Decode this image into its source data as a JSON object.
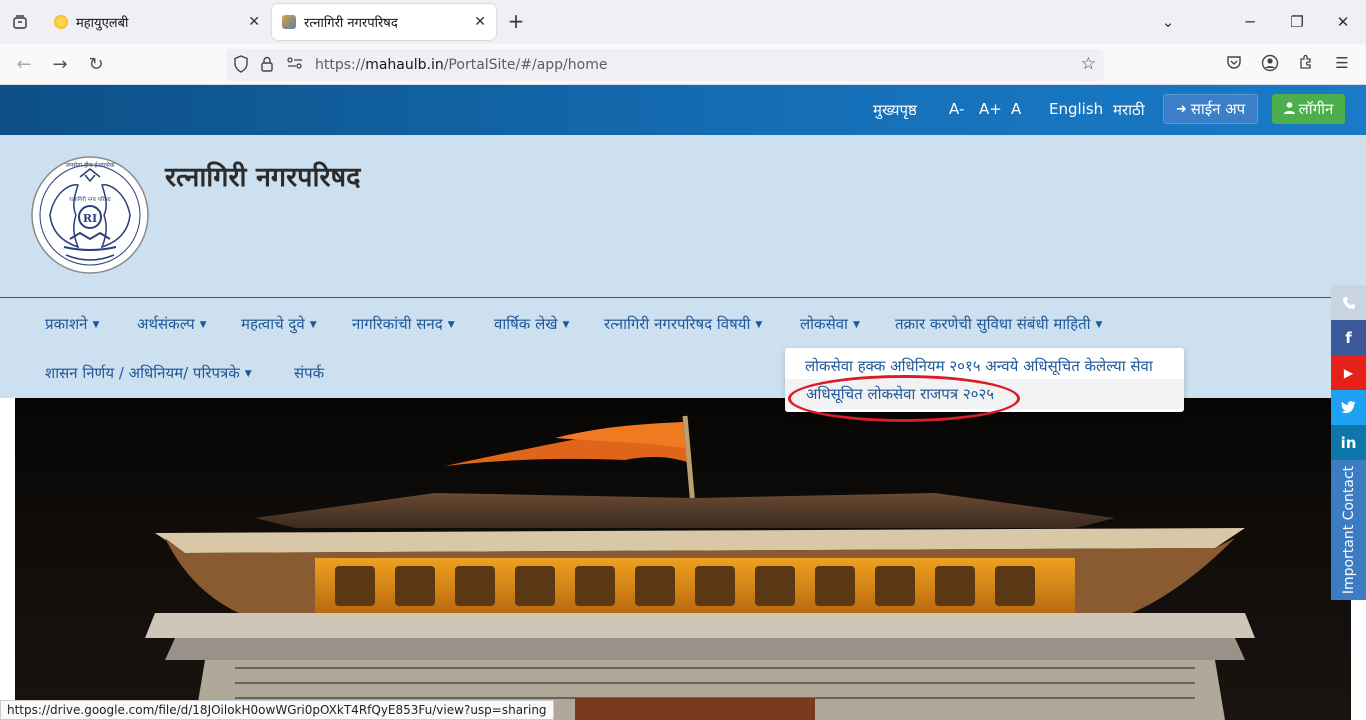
{
  "browser": {
    "tabs": [
      {
        "title": "महायुएलबी",
        "favicon_color": "#f0b400"
      },
      {
        "title": "रत्नागिरी नगरपरिषद",
        "favicon_color": "#c77a2a"
      }
    ],
    "url": {
      "prefix": "https://",
      "host": "mahaulb.in",
      "path": "/PortalSite/#/app/home"
    },
    "status_url": "https://drive.google.com/file/d/18JOilokH0owWGri0pOXkT4RfQyE853Fu/view?usp=sharing"
  },
  "topbar": {
    "home": "मुख्यपृष्ठ",
    "font_small": "A-",
    "font_large": "A+",
    "font_normal": "A",
    "lang_en": "English",
    "lang_mr": "मराठी",
    "signup": "साईन अप",
    "login": "लॉगीन"
  },
  "site": {
    "title": "रत्नागिरी नगरपरिषद",
    "logo_motto": "जनसेवा हीच ईश्वरसेवा",
    "logo_text": "रत्नागिरी नगर परिषद",
    "logo_mark": "RI"
  },
  "menu": {
    "row1": [
      "प्रकाशने",
      "अर्थसंकल्प",
      "महत्वाचे दुवे",
      "नागरिकांची सनद",
      "वार्षिक लेखे",
      "रत्नागिरी नगरपरिषद विषयी",
      "लोकसेवा",
      "तक्रार करणेची सुविधा संबंधी माहिती"
    ],
    "row2": [
      "शासन निर्णय / अधिनियम/ परिपत्रके",
      "संपर्क"
    ]
  },
  "dropdown": {
    "items": [
      "लोकसेवा हक्क अधिनियम २०१५ अन्वये अधिसूचित केलेल्या सेवा",
      "अधिसूचित लोकसेवा राजपत्र २०२५"
    ]
  },
  "social": {
    "phone": "phone-icon",
    "facebook": "f",
    "youtube": "▶",
    "twitter": "twitter-icon",
    "linkedin": "in",
    "important_contact": "Important Contact"
  },
  "colors": {
    "accent": "#1f5797",
    "header_bg": "#cde0ef",
    "login_green": "#4cae4c",
    "highlight_red": "#d81e2a"
  }
}
